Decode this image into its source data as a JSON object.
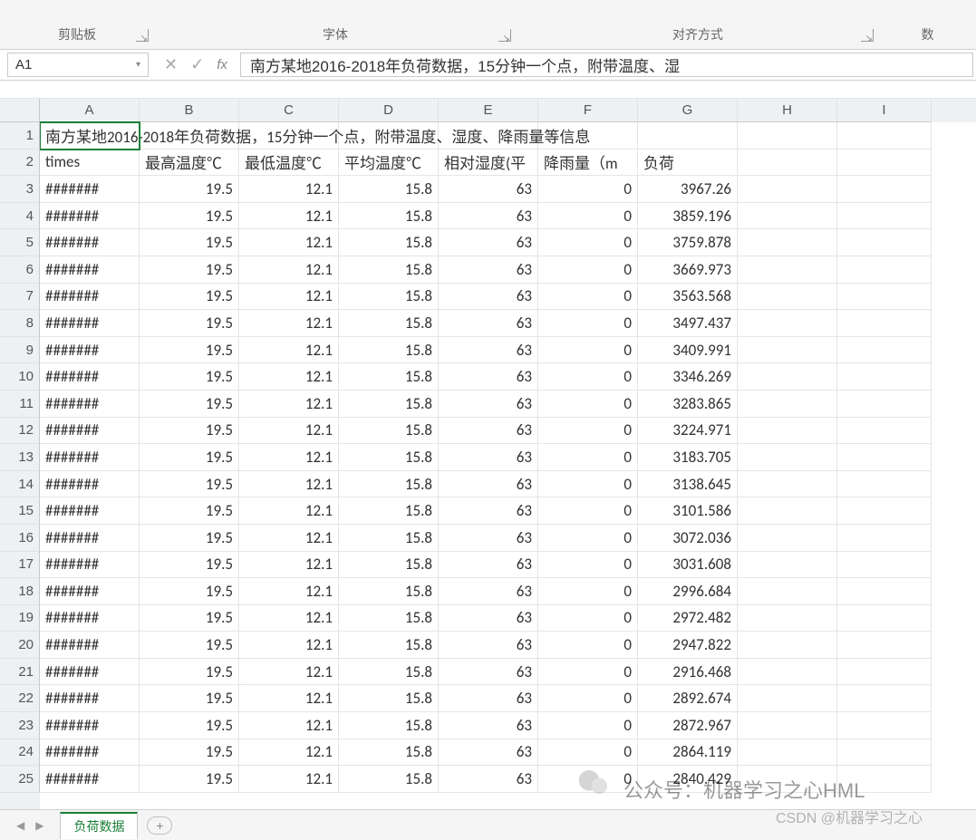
{
  "ribbon": {
    "group_clipboard": "剪贴板",
    "group_font": "字体",
    "group_alignment": "对齐方式",
    "group_number_partial": "数"
  },
  "namebox": {
    "value": "A1"
  },
  "formula_bar": {
    "cancel": "✕",
    "enter": "✓",
    "fx": "fx",
    "content": "南方某地2016-2018年负荷数据，15分钟一个点，附带温度、湿"
  },
  "columns": [
    "A",
    "B",
    "C",
    "D",
    "E",
    "F",
    "G",
    "H",
    "I"
  ],
  "row_numbers": [
    1,
    2,
    3,
    4,
    5,
    6,
    7,
    8,
    9,
    10,
    11,
    12,
    13,
    14,
    15,
    16,
    17,
    18,
    19,
    20,
    21,
    22,
    23,
    24,
    25
  ],
  "row1_text": "南方某地2016-2018年负荷数据，15分钟一个点，附带温度、湿度、降雨量等信息",
  "row2_headers": {
    "A": "times",
    "B": "最高温度℃",
    "C": "最低温度℃",
    "D": "平均温度℃",
    "E": "相对湿度(平",
    "F": "降雨量（m",
    "G": "负荷"
  },
  "data_rows": [
    {
      "A": "#######",
      "B": "19.5",
      "C": "12.1",
      "D": "15.8",
      "E": "63",
      "F": "0",
      "G": "3967.26"
    },
    {
      "A": "#######",
      "B": "19.5",
      "C": "12.1",
      "D": "15.8",
      "E": "63",
      "F": "0",
      "G": "3859.196"
    },
    {
      "A": "#######",
      "B": "19.5",
      "C": "12.1",
      "D": "15.8",
      "E": "63",
      "F": "0",
      "G": "3759.878"
    },
    {
      "A": "#######",
      "B": "19.5",
      "C": "12.1",
      "D": "15.8",
      "E": "63",
      "F": "0",
      "G": "3669.973"
    },
    {
      "A": "#######",
      "B": "19.5",
      "C": "12.1",
      "D": "15.8",
      "E": "63",
      "F": "0",
      "G": "3563.568"
    },
    {
      "A": "#######",
      "B": "19.5",
      "C": "12.1",
      "D": "15.8",
      "E": "63",
      "F": "0",
      "G": "3497.437"
    },
    {
      "A": "#######",
      "B": "19.5",
      "C": "12.1",
      "D": "15.8",
      "E": "63",
      "F": "0",
      "G": "3409.991"
    },
    {
      "A": "#######",
      "B": "19.5",
      "C": "12.1",
      "D": "15.8",
      "E": "63",
      "F": "0",
      "G": "3346.269"
    },
    {
      "A": "#######",
      "B": "19.5",
      "C": "12.1",
      "D": "15.8",
      "E": "63",
      "F": "0",
      "G": "3283.865"
    },
    {
      "A": "#######",
      "B": "19.5",
      "C": "12.1",
      "D": "15.8",
      "E": "63",
      "F": "0",
      "G": "3224.971"
    },
    {
      "A": "#######",
      "B": "19.5",
      "C": "12.1",
      "D": "15.8",
      "E": "63",
      "F": "0",
      "G": "3183.705"
    },
    {
      "A": "#######",
      "B": "19.5",
      "C": "12.1",
      "D": "15.8",
      "E": "63",
      "F": "0",
      "G": "3138.645"
    },
    {
      "A": "#######",
      "B": "19.5",
      "C": "12.1",
      "D": "15.8",
      "E": "63",
      "F": "0",
      "G": "3101.586"
    },
    {
      "A": "#######",
      "B": "19.5",
      "C": "12.1",
      "D": "15.8",
      "E": "63",
      "F": "0",
      "G": "3072.036"
    },
    {
      "A": "#######",
      "B": "19.5",
      "C": "12.1",
      "D": "15.8",
      "E": "63",
      "F": "0",
      "G": "3031.608"
    },
    {
      "A": "#######",
      "B": "19.5",
      "C": "12.1",
      "D": "15.8",
      "E": "63",
      "F": "0",
      "G": "2996.684"
    },
    {
      "A": "#######",
      "B": "19.5",
      "C": "12.1",
      "D": "15.8",
      "E": "63",
      "F": "0",
      "G": "2972.482"
    },
    {
      "A": "#######",
      "B": "19.5",
      "C": "12.1",
      "D": "15.8",
      "E": "63",
      "F": "0",
      "G": "2947.822"
    },
    {
      "A": "#######",
      "B": "19.5",
      "C": "12.1",
      "D": "15.8",
      "E": "63",
      "F": "0",
      "G": "2916.468"
    },
    {
      "A": "#######",
      "B": "19.5",
      "C": "12.1",
      "D": "15.8",
      "E": "63",
      "F": "0",
      "G": "2892.674"
    },
    {
      "A": "#######",
      "B": "19.5",
      "C": "12.1",
      "D": "15.8",
      "E": "63",
      "F": "0",
      "G": "2872.967"
    },
    {
      "A": "#######",
      "B": "19.5",
      "C": "12.1",
      "D": "15.8",
      "E": "63",
      "F": "0",
      "G": "2864.119"
    },
    {
      "A": "#######",
      "B": "19.5",
      "C": "12.1",
      "D": "15.8",
      "E": "63",
      "F": "0",
      "G": "2840.429"
    }
  ],
  "sheet_tabs": {
    "active": "负荷数据",
    "new_label": "+"
  },
  "sheet_nav": {
    "prev": "◀",
    "next": "▶"
  },
  "watermarks": {
    "w1": "公众号：机器学习之心HML",
    "w2": "CSDN @机器学习之心"
  }
}
